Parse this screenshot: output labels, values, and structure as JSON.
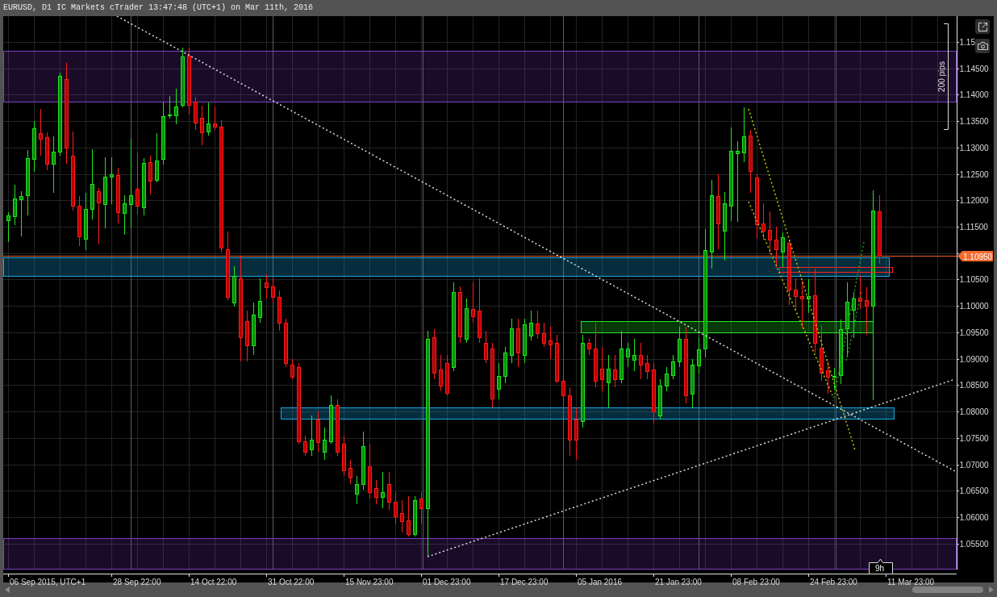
{
  "window": {
    "title": "EURUSD, D1 IC Markets cTrader 13:47:48 (UTC+1) on Mar 11th, 2016"
  },
  "chart": {
    "measure_label": "200 pips",
    "current_price": "1.10950",
    "countdown": "9h"
  },
  "price_axis": {
    "labels": [
      "1.15",
      "1.14500",
      "1.14000",
      "1.13500",
      "1.13000",
      "1.12500",
      "1.12000",
      "1.11500",
      "1.10500",
      "1.10000",
      "1.09500",
      "1.09000",
      "1.08500",
      "1.08000",
      "1.07500",
      "1.07000",
      "1.06500",
      "1.06000",
      "1.05500"
    ]
  },
  "time_axis": {
    "labels": [
      "06 Sep 2015, UTC+1",
      "28 Sep 22:00",
      "14 Oct 22:00",
      "31 Oct 22:00",
      "15 Nov 23:00",
      "01 Dec 23:00",
      "17 Dec 23:00",
      "05 Jan 2016",
      "21 Jan 23:00",
      "08 Feb 23:00",
      "24 Feb 23:00",
      "11 Mar 23:00"
    ]
  }
}
